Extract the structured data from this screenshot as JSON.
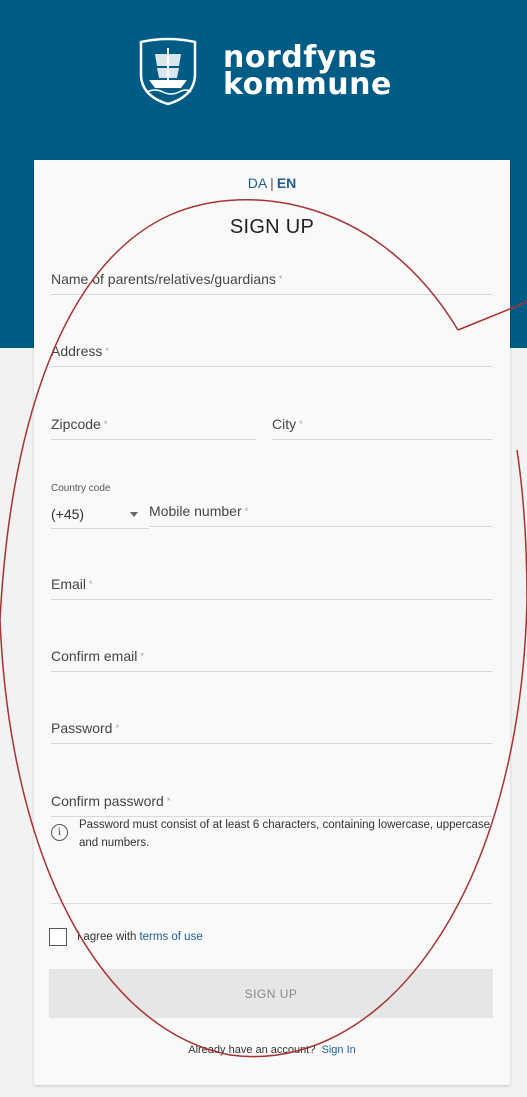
{
  "brand": {
    "line1": "nordfyns",
    "line2": "kommune",
    "header_color": "#005b85",
    "crest_icon": "ship-crest-icon"
  },
  "language": {
    "da": "DA",
    "separator": "|",
    "en": "EN",
    "active": "EN"
  },
  "form": {
    "title": "SIGN UP",
    "required_mark": "*",
    "fields": {
      "name": "Name of parents/relatives/guardians",
      "address": "Address",
      "zipcode": "Zipcode",
      "city": "City",
      "country_code_label": "Country code",
      "country_code_value": "(+45)",
      "mobile": "Mobile number",
      "email": "Email",
      "confirm_email": "Confirm email",
      "password": "Password",
      "confirm_password": "Confirm password"
    },
    "password_hint": "Password must consist of at least 6 characters, containing lowercase, uppercase and numbers.",
    "info_icon": "info-icon",
    "agree_text": "I agree with",
    "terms_link": "terms of use",
    "submit_label": "SIGN UP",
    "already_text": "Already have an account?",
    "signin_link": "Sign In",
    "link_color": "#1f5f8f",
    "annotation_color": "#a83232"
  }
}
